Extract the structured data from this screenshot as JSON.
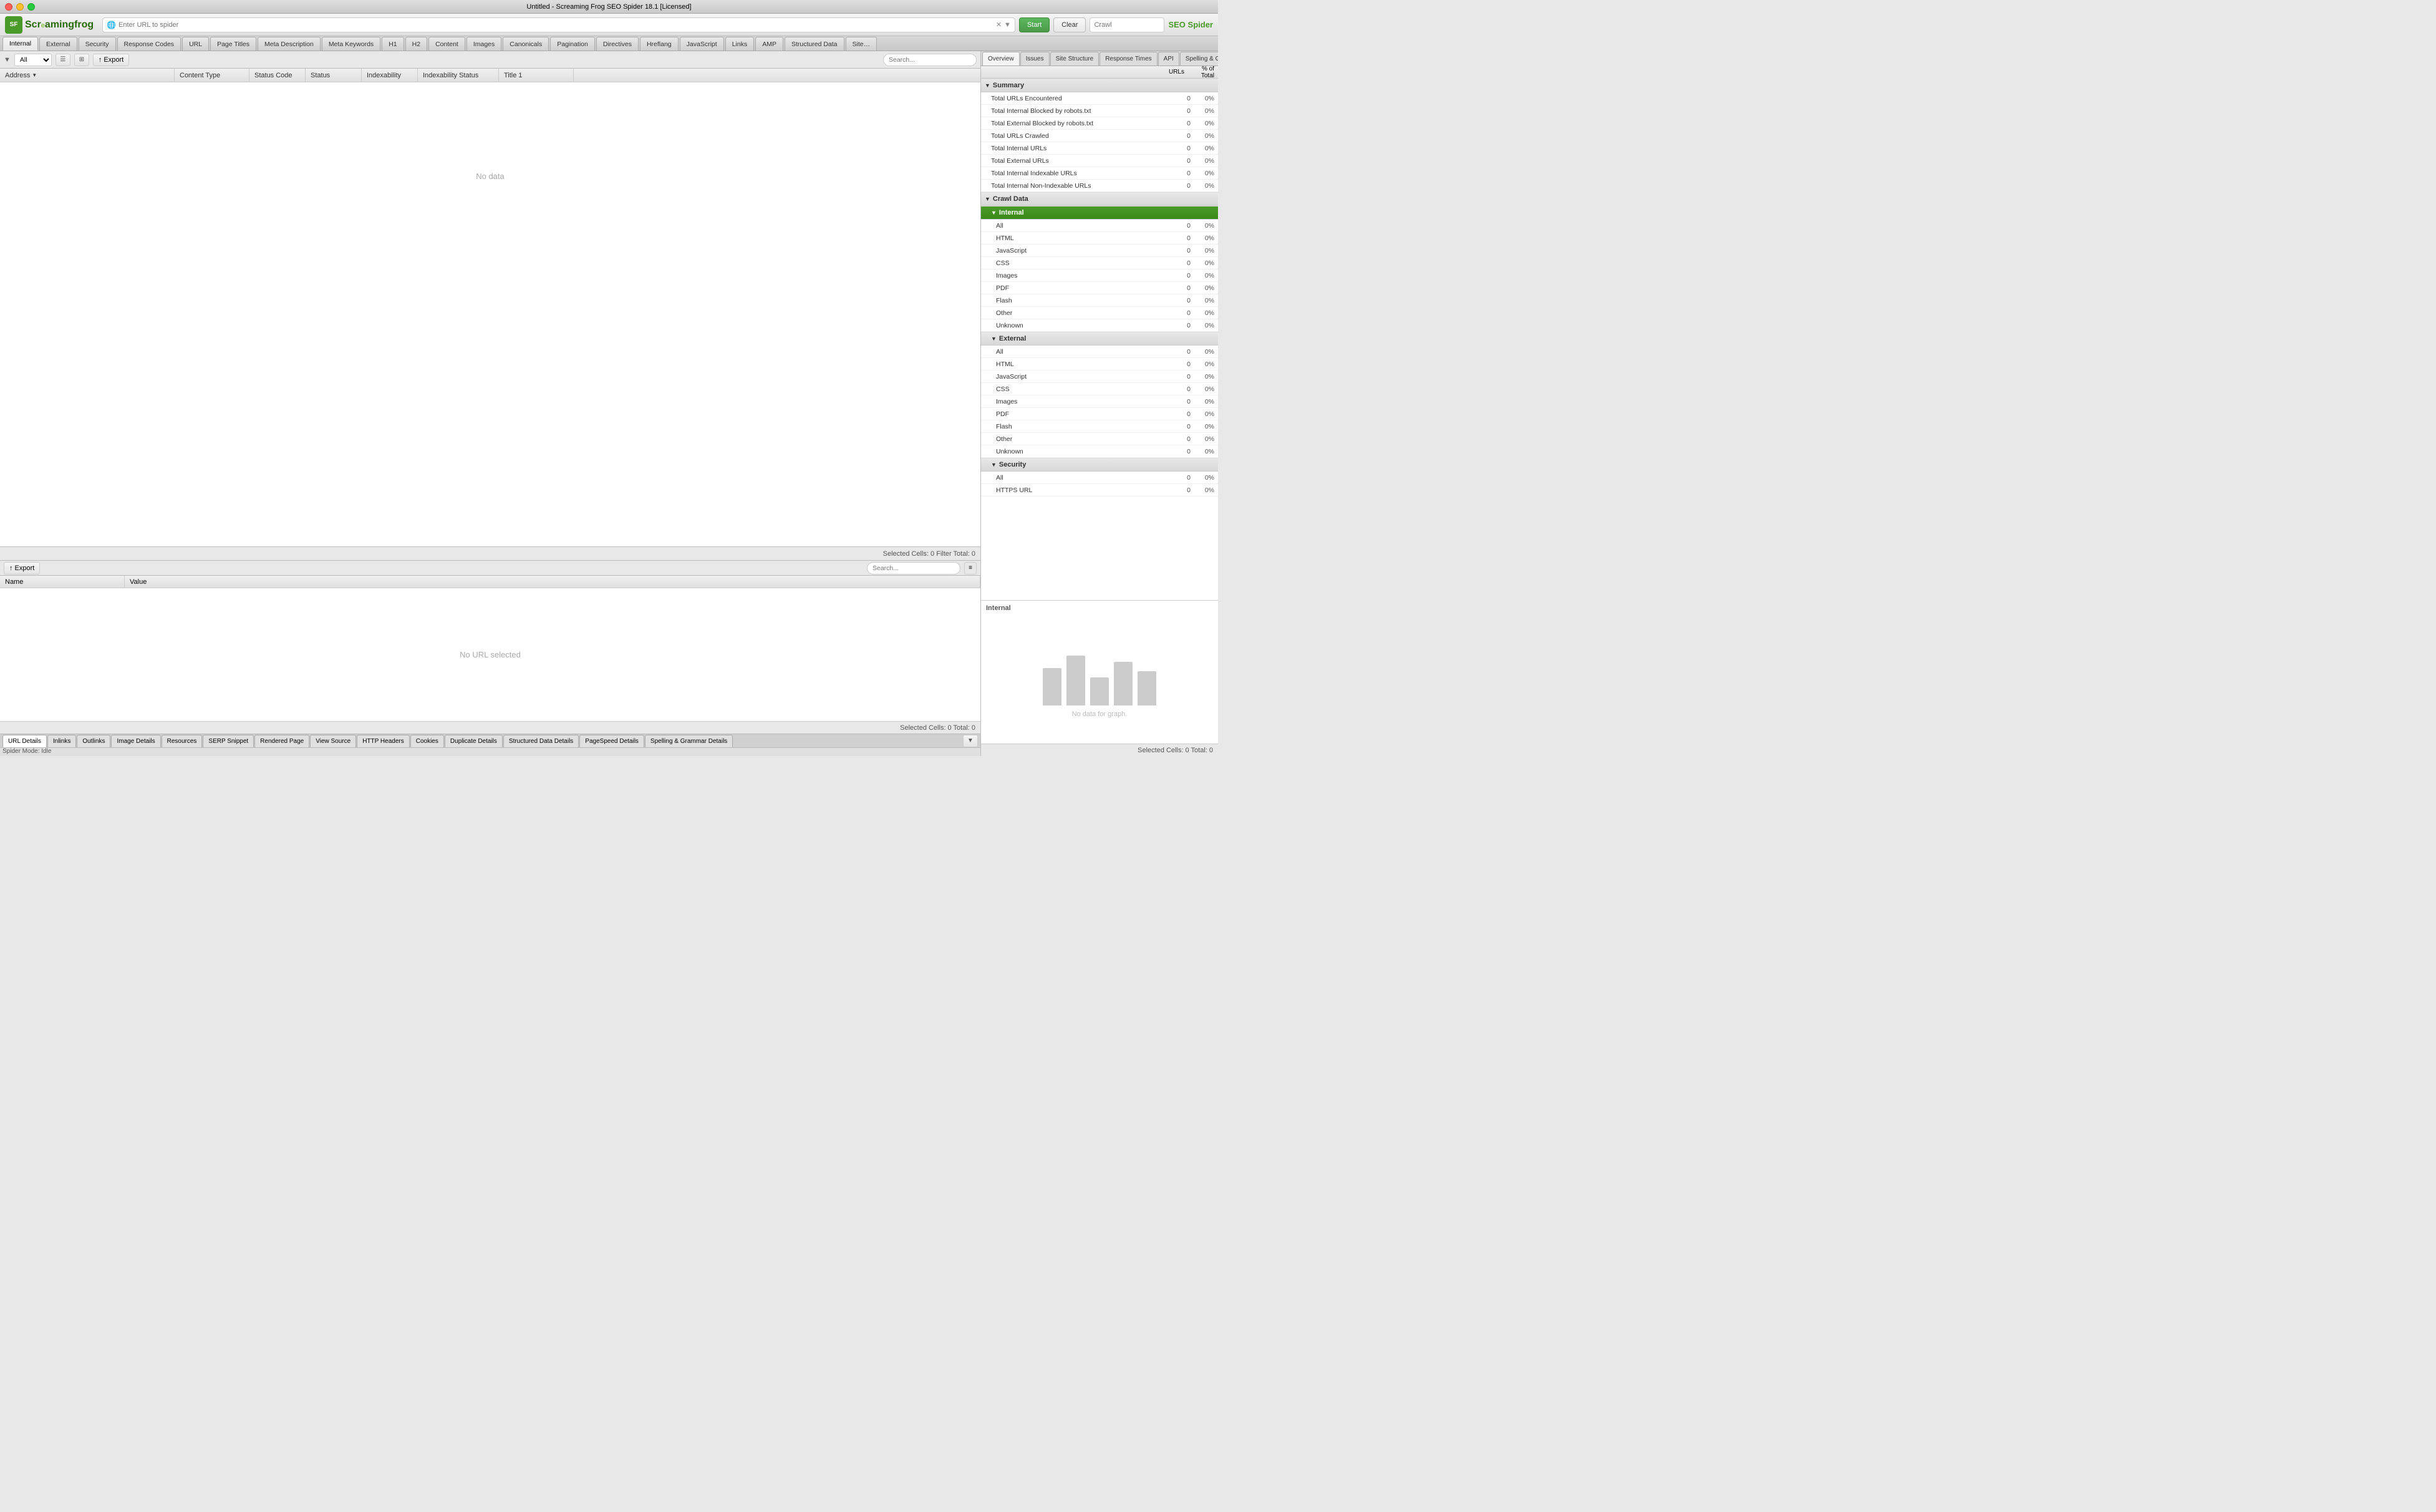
{
  "titlebar": {
    "title": "Untitled - Screaming Frog SEO Spider 18.1 [Licensed]"
  },
  "toolbar": {
    "url_placeholder": "Enter URL to spider",
    "start_label": "Start",
    "clear_label": "Clear",
    "crawl_placeholder": "Crawl",
    "seo_spider_label": "SEO Spider"
  },
  "nav_tabs": [
    {
      "id": "internal",
      "label": "Internal"
    },
    {
      "id": "external",
      "label": "External"
    },
    {
      "id": "security",
      "label": "Security"
    },
    {
      "id": "response-codes",
      "label": "Response Codes"
    },
    {
      "id": "url",
      "label": "URL"
    },
    {
      "id": "page-titles",
      "label": "Page Titles"
    },
    {
      "id": "meta-description",
      "label": "Meta Description"
    },
    {
      "id": "meta-keywords",
      "label": "Meta Keywords"
    },
    {
      "id": "h1",
      "label": "H1"
    },
    {
      "id": "h2",
      "label": "H2"
    },
    {
      "id": "content",
      "label": "Content"
    },
    {
      "id": "images",
      "label": "Images"
    },
    {
      "id": "canonicals",
      "label": "Canonicals"
    },
    {
      "id": "pagination",
      "label": "Pagination"
    },
    {
      "id": "directives",
      "label": "Directives"
    },
    {
      "id": "hreflang",
      "label": "Hreflang"
    },
    {
      "id": "javascript",
      "label": "JavaScript"
    },
    {
      "id": "links",
      "label": "Links"
    },
    {
      "id": "amp",
      "label": "AMP"
    },
    {
      "id": "structured-data",
      "label": "Structured Data"
    },
    {
      "id": "sitemaps",
      "label": "Site…"
    }
  ],
  "filter_bar": {
    "filter_label": "All",
    "export_label": "Export",
    "search_placeholder": "Search..."
  },
  "table": {
    "columns": [
      {
        "id": "address",
        "label": "Address"
      },
      {
        "id": "content-type",
        "label": "Content Type"
      },
      {
        "id": "status-code",
        "label": "Status Code"
      },
      {
        "id": "status",
        "label": "Status"
      },
      {
        "id": "indexability",
        "label": "Indexability"
      },
      {
        "id": "indexability-status",
        "label": "Indexability Status"
      },
      {
        "id": "title1",
        "label": "Title 1"
      }
    ],
    "no_data": "No data",
    "status_bar": "Selected Cells: 0  Filter Total: 0"
  },
  "bottom_section": {
    "export_label": "Export",
    "search_placeholder": "Search...",
    "columns": [
      {
        "id": "name",
        "label": "Name"
      },
      {
        "id": "value",
        "label": "Value"
      }
    ],
    "no_url": "No URL selected",
    "status_bar": "Selected Cells: 0  Total: 0"
  },
  "bottom_tabs": [
    {
      "id": "url-details",
      "label": "URL Details"
    },
    {
      "id": "inlinks",
      "label": "Inlinks"
    },
    {
      "id": "outlinks",
      "label": "Outlinks"
    },
    {
      "id": "image-details",
      "label": "Image Details"
    },
    {
      "id": "resources",
      "label": "Resources"
    },
    {
      "id": "serp-snippet",
      "label": "SERP Snippet"
    },
    {
      "id": "rendered-page",
      "label": "Rendered Page"
    },
    {
      "id": "view-source",
      "label": "View Source"
    },
    {
      "id": "http-headers",
      "label": "HTTP Headers"
    },
    {
      "id": "cookies",
      "label": "Cookies"
    },
    {
      "id": "duplicate-details",
      "label": "Duplicate Details"
    },
    {
      "id": "structured-data-details",
      "label": "Structured Data Details"
    },
    {
      "id": "pagespeed-details",
      "label": "PageSpeed Details"
    },
    {
      "id": "spelling-grammar-details",
      "label": "Spelling & Grammar Details"
    }
  ],
  "right_panel": {
    "tabs": [
      {
        "id": "overview",
        "label": "Overview"
      },
      {
        "id": "issues",
        "label": "Issues"
      },
      {
        "id": "site-structure",
        "label": "Site Structure"
      },
      {
        "id": "response-times",
        "label": "Response Times"
      },
      {
        "id": "api",
        "label": "API"
      },
      {
        "id": "spelling-grammar",
        "label": "Spelling & Grammar"
      },
      {
        "id": "urls",
        "label": "URLs"
      },
      {
        "id": "percent-total",
        "label": "% of Total"
      }
    ],
    "sections": [
      {
        "id": "summary",
        "label": "Summary",
        "rows": [
          {
            "label": "Total URLs Encountered",
            "value": "0",
            "percent": "0%"
          },
          {
            "label": "Total Internal Blocked by robots.txt",
            "value": "0",
            "percent": "0%"
          },
          {
            "label": "Total External Blocked by robots.txt",
            "value": "0",
            "percent": "0%"
          },
          {
            "label": "Total URLs Crawled",
            "value": "0",
            "percent": "0%"
          },
          {
            "label": "Total Internal URLs",
            "value": "0",
            "percent": "0%"
          },
          {
            "label": "Total External URLs",
            "value": "0",
            "percent": "0%"
          },
          {
            "label": "Total Internal Indexable URLs",
            "value": "0",
            "percent": "0%"
          },
          {
            "label": "Total Internal Non-Indexable URLs",
            "value": "0",
            "percent": "0%"
          }
        ]
      },
      {
        "id": "crawl-data",
        "label": "Crawl Data",
        "subsections": [
          {
            "id": "internal",
            "label": "Internal",
            "selected": true,
            "rows": [
              {
                "label": "All",
                "value": "0",
                "percent": "0%"
              },
              {
                "label": "HTML",
                "value": "0",
                "percent": "0%"
              },
              {
                "label": "JavaScript",
                "value": "0",
                "percent": "0%"
              },
              {
                "label": "CSS",
                "value": "0",
                "percent": "0%"
              },
              {
                "label": "Images",
                "value": "0",
                "percent": "0%"
              },
              {
                "label": "PDF",
                "value": "0",
                "percent": "0%"
              },
              {
                "label": "Flash",
                "value": "0",
                "percent": "0%"
              },
              {
                "label": "Other",
                "value": "0",
                "percent": "0%"
              },
              {
                "label": "Unknown",
                "value": "0",
                "percent": "0%"
              }
            ]
          },
          {
            "id": "external",
            "label": "External",
            "rows": [
              {
                "label": "All",
                "value": "0",
                "percent": "0%"
              },
              {
                "label": "HTML",
                "value": "0",
                "percent": "0%"
              },
              {
                "label": "JavaScript",
                "value": "0",
                "percent": "0%"
              },
              {
                "label": "CSS",
                "value": "0",
                "percent": "0%"
              },
              {
                "label": "Images",
                "value": "0",
                "percent": "0%"
              },
              {
                "label": "PDF",
                "value": "0",
                "percent": "0%"
              },
              {
                "label": "Flash",
                "value": "0",
                "percent": "0%"
              },
              {
                "label": "Other",
                "value": "0",
                "percent": "0%"
              },
              {
                "label": "Unknown",
                "value": "0",
                "percent": "0%"
              }
            ]
          },
          {
            "id": "security",
            "label": "Security",
            "rows": [
              {
                "label": "All",
                "value": "0",
                "percent": "0%"
              },
              {
                "label": "HTTPS URL",
                "value": "0",
                "percent": "0%"
              }
            ]
          }
        ]
      }
    ],
    "graph": {
      "title": "Internal",
      "no_data": "No data for graph."
    },
    "status_bar": "Selected Cells: 0  Total: 0"
  },
  "spider_mode": "Spider Mode: Idle"
}
